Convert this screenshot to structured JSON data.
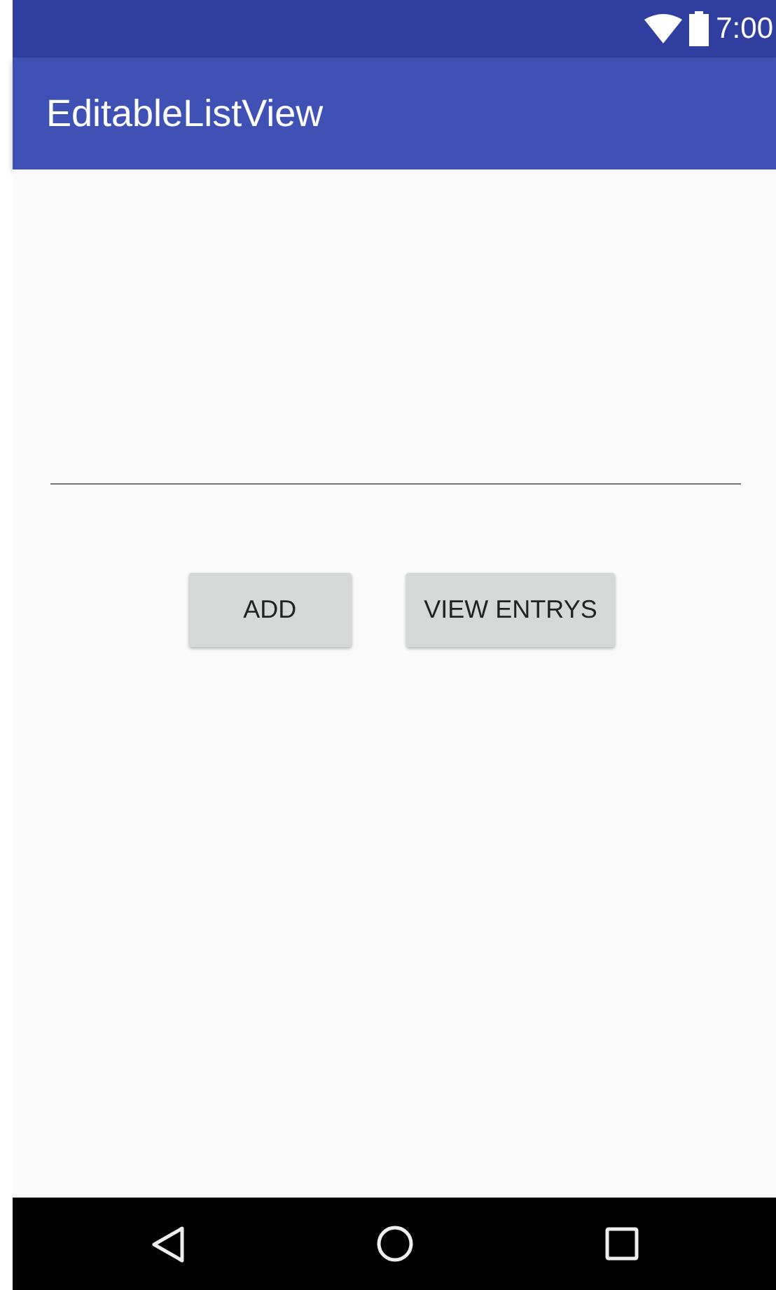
{
  "status_bar": {
    "time": "7:00"
  },
  "app_bar": {
    "title": "EditableListView"
  },
  "buttons": [
    {
      "label": "ADD"
    },
    {
      "label": "VIEW ENTRYS"
    }
  ]
}
